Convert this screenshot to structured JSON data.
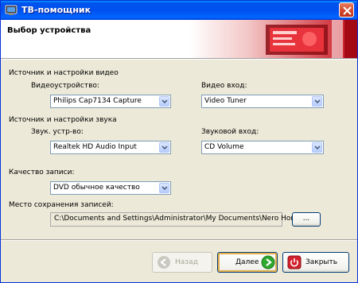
{
  "window": {
    "title": "ТВ-помощник",
    "header_title": "Выбор устройства"
  },
  "video": {
    "section_label": "Источник и настройки видео",
    "device_label": "Видеоустройство:",
    "device_value": "Philips Cap7134 Capture",
    "input_label": "Видео вход:",
    "input_value": "Video Tuner"
  },
  "audio": {
    "section_label": "Источник и настройки звука",
    "device_label": "Звук. устр-во:",
    "device_value": "Realtek HD Audio Input",
    "input_label": "Звуковой вход:",
    "input_value": "CD Volume"
  },
  "quality": {
    "label": "Качество записи:",
    "value": "DVD обычное качество"
  },
  "save": {
    "label": "Место сохранения записей:",
    "path": "C:\\Documents and Settings\\Administrator\\My Documents\\Nero Home\\TV",
    "browse_label": "..."
  },
  "buttons": {
    "back_label": "Назад",
    "next_label": "Далее",
    "close_label": "Закрыть"
  },
  "colors": {
    "titlebar": "#0050ee",
    "accent_red": "#d4202c",
    "next_green": "#2fa82f"
  }
}
